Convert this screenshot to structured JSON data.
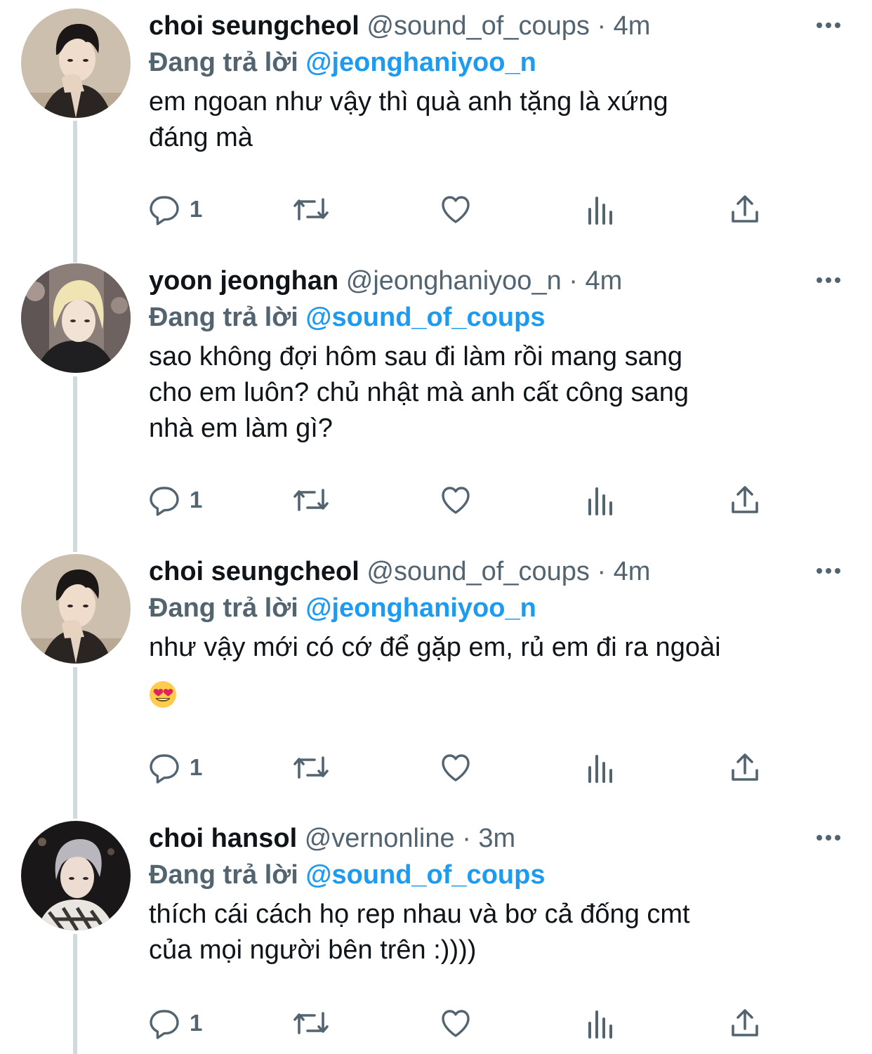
{
  "tweets": [
    {
      "display_name": "choi seungcheol",
      "handle": "@sound_of_coups",
      "separator": "·",
      "time": "4m",
      "reply_prefix": "Đang trả lời",
      "reply_to": "@jeonghaniyoo_n",
      "text_lines": [
        "em ngoan như vậy thì quà anh tặng là xứng",
        "đáng mà"
      ],
      "reply_count": "1",
      "avatar": "avatar-dark-hair-man"
    },
    {
      "display_name": "yoon jeonghan",
      "handle": "@jeonghaniyoo_n",
      "separator": "·",
      "time": "4m",
      "reply_prefix": "Đang trả lời",
      "reply_to": "@sound_of_coups",
      "text_lines": [
        "sao không đợi hôm sau đi làm rồi mang sang",
        "cho em luôn? chủ nhật mà anh cất công sang",
        "nhà em làm gì?"
      ],
      "reply_count": "1",
      "avatar": "avatar-blonde-hair-man"
    },
    {
      "display_name": "choi seungcheol",
      "handle": "@sound_of_coups",
      "separator": "·",
      "time": "4m",
      "reply_prefix": "Đang trả lời",
      "reply_to": "@jeonghaniyoo_n",
      "text_lines": [
        "như vậy mới có cớ để gặp em, rủ em đi ra ngoài"
      ],
      "emoji": "smiling-face-with-heart-eyes",
      "reply_count": "1",
      "avatar": "avatar-dark-hair-man"
    },
    {
      "display_name": "choi hansol",
      "handle": "@vernonline",
      "separator": "·",
      "time": "3m",
      "reply_prefix": "Đang trả lời",
      "reply_to": "@sound_of_coups",
      "text_lines": [
        "thích cái cách họ rep nhau và bơ cả đống cmt",
        "của mọi người bên trên :))))"
      ],
      "reply_count": "1",
      "avatar": "avatar-silver-hair-man"
    }
  ],
  "icons": {
    "reply": "speech-bubble-icon",
    "retweet": "retweet-arrows-icon",
    "like": "heart-icon",
    "analytics": "bar-chart-icon",
    "share": "share-upload-icon",
    "more": "more-dots-icon"
  },
  "colors": {
    "text": "#0f1419",
    "secondary": "#536471",
    "link": "#1d9bf0",
    "thread_line": "#cfd9de",
    "background": "#ffffff"
  }
}
